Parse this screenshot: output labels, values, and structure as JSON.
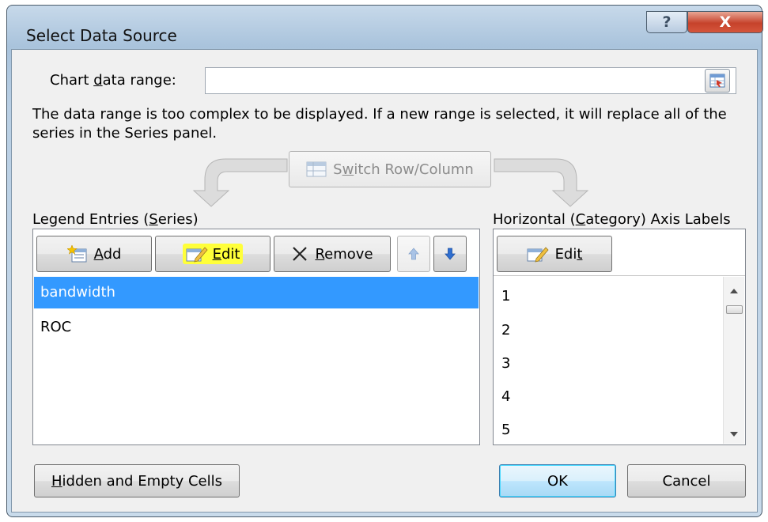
{
  "window": {
    "title": "Select Data Source",
    "help_glyph": "?",
    "close_glyph": "X"
  },
  "chart_range": {
    "label_pre": "Chart ",
    "label_mn": "d",
    "label_post": "ata range:",
    "value": ""
  },
  "message": "The data range is too complex to be displayed. If a new range is selected, it will replace all of the series in the Series panel.",
  "switch_button": {
    "pre": "S",
    "mn": "w",
    "post": "itch Row/Column"
  },
  "legend": {
    "title_pre": "Legend Entries (",
    "title_mn": "S",
    "title_post": "eries)",
    "add_mn": "A",
    "add_post": "dd",
    "edit_mn": "E",
    "edit_post": "dit",
    "remove_mn": "R",
    "remove_post": "emove",
    "series": [
      "bandwidth",
      "ROC"
    ],
    "selected_index": 0,
    "edit_highlight_color": "#ffff3a"
  },
  "axis": {
    "title_pre": "Horizontal (",
    "title_mn": "C",
    "title_post": "ategory) Axis Labels",
    "edit_pre": "Edi",
    "edit_mn": "t",
    "labels": [
      "1",
      "2",
      "3",
      "4",
      "5"
    ]
  },
  "footer": {
    "hidden_mn": "H",
    "hidden_post": "idden and Empty Cells",
    "ok": "OK",
    "cancel": "Cancel"
  },
  "colors": {
    "selection": "#3399ff",
    "close_button": "#c6422b"
  }
}
